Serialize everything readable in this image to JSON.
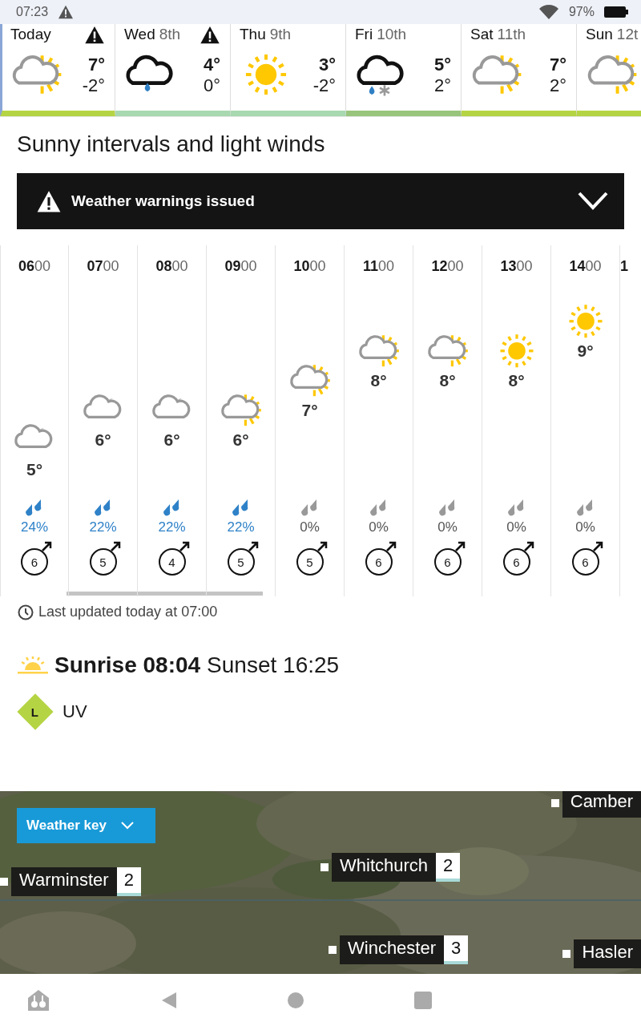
{
  "status_bar": {
    "time": "07:23",
    "battery": "97%"
  },
  "days": [
    {
      "name": "Today",
      "warning": true,
      "selected": true,
      "kind": "sunny-intervals",
      "high": "7°",
      "low": "-2°",
      "color": "#b5d444"
    },
    {
      "name": "Wed",
      "date": "8th",
      "warning": true,
      "selected": false,
      "kind": "rain",
      "high": "4°",
      "low": "0°",
      "color": "#a8d8b0"
    },
    {
      "name": "Thu",
      "date": "9th",
      "warning": false,
      "selected": false,
      "kind": "sunny",
      "high": "3°",
      "low": "-2°",
      "color": "#a8d8b0"
    },
    {
      "name": "Fri",
      "date": "10th",
      "warning": false,
      "selected": false,
      "kind": "sleet",
      "high": "5°",
      "low": "2°",
      "color": "#98c47c"
    },
    {
      "name": "Sat",
      "date": "11th",
      "warning": false,
      "selected": false,
      "kind": "sunny-intervals",
      "high": "7°",
      "low": "2°",
      "color": "#b5d444"
    },
    {
      "name": "Sun",
      "date": "12t",
      "warning": false,
      "selected": false,
      "kind": "sunny-intervals",
      "color": "#b5d444"
    }
  ],
  "summary": "Sunny intervals and light winds",
  "warning_banner": {
    "label": "Weather warnings issued",
    "expanded": false
  },
  "hours": [
    {
      "hour": "06",
      "minutes": "00",
      "kind": "night-cloud",
      "temp": "5°",
      "rain": "24%",
      "wet": true,
      "wind": "6"
    },
    {
      "hour": "07",
      "minutes": "00",
      "kind": "night-cloud",
      "temp": "6°",
      "rain": "22%",
      "wet": true,
      "wind": "5"
    },
    {
      "hour": "08",
      "minutes": "00",
      "kind": "night-cloud",
      "temp": "6°",
      "rain": "22%",
      "wet": true,
      "wind": "4"
    },
    {
      "hour": "09",
      "minutes": "00",
      "kind": "sunny-intervals",
      "temp": "6°",
      "rain": "22%",
      "wet": true,
      "wind": "5"
    },
    {
      "hour": "10",
      "minutes": "00",
      "kind": "sunny-intervals",
      "temp": "7°",
      "rain": "0%",
      "wet": false,
      "wind": "5"
    },
    {
      "hour": "11",
      "minutes": "00",
      "kind": "sunny-intervals",
      "temp": "8°",
      "rain": "0%",
      "wet": false,
      "wind": "6"
    },
    {
      "hour": "12",
      "minutes": "00",
      "kind": "sunny-intervals",
      "temp": "8°",
      "rain": "0%",
      "wet": false,
      "wind": "6"
    },
    {
      "hour": "13",
      "minutes": "00",
      "kind": "sunny",
      "temp": "8°",
      "rain": "0%",
      "wet": false,
      "wind": "6"
    },
    {
      "hour": "14",
      "minutes": "00",
      "kind": "sunny",
      "temp": "9°",
      "rain": "0%",
      "wet": false,
      "wind": "6"
    },
    {
      "hour": "1"
    }
  ],
  "last_updated": "Last updated today at 07:00",
  "sun": {
    "sunrise": "Sunrise 08:04",
    "sunset": "Sunset 16:25"
  },
  "uv": {
    "level_letter": "L",
    "label": "UV",
    "color": "#b5d444"
  },
  "map": {
    "weather_key": "Weather key",
    "places": [
      {
        "name": "Warminster",
        "value": "2"
      },
      {
        "name": "Whitchurch",
        "value": "2"
      },
      {
        "name": "Winchester",
        "value": "3"
      },
      {
        "name": "Camber"
      },
      {
        "name": "Hasler"
      }
    ]
  }
}
